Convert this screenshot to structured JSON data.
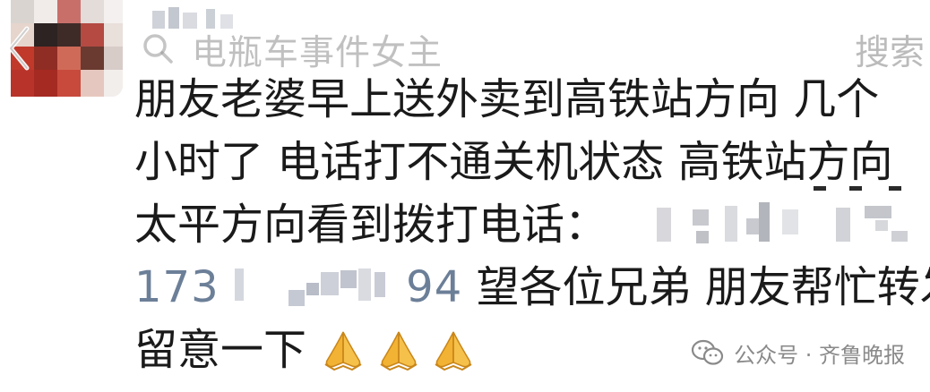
{
  "search": {
    "query": "电瓶车事件女主",
    "button_label": "搜索"
  },
  "post": {
    "line1": "朋友老婆早上送外卖到高铁站方向 几个",
    "line2": "小时了 电话打不通关机状态 高铁站方向",
    "line3": "太平方向看到拨打电话：",
    "phone_prefix": "173",
    "phone_suffix": "94",
    "line4_rest": " 望各位兄弟 朋友帮忙转发",
    "line5": "留意一下"
  },
  "emojis": [
    "praying-hands-icon",
    "praying-hands-icon",
    "praying-hands-icon"
  ],
  "watermark": {
    "text": "公众号 · 齐鲁晚报"
  },
  "colors": {
    "text": "#1a1a1a",
    "phone": "#6c7f98",
    "watermark": "#8a8a8a",
    "emoji_gold": "#f2b233"
  }
}
